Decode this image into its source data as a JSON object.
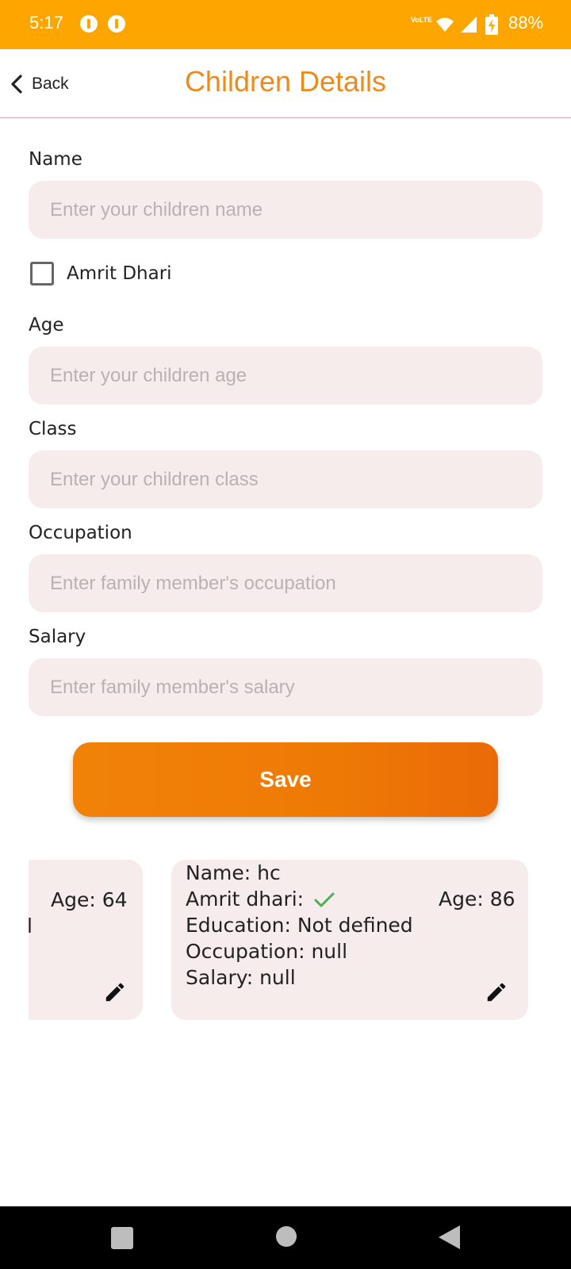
{
  "status_bar": {
    "time": "5:17",
    "network_label": "VoLTE",
    "battery": "88%"
  },
  "header": {
    "back_label": "Back",
    "title": "Children Details"
  },
  "form": {
    "name": {
      "label": "Name",
      "placeholder": "Enter your children name"
    },
    "amrit_dhari": {
      "label": "Amrit Dhari",
      "checked": false
    },
    "age": {
      "label": "Age",
      "placeholder": "Enter your children age"
    },
    "class": {
      "label": "Class",
      "placeholder": "Enter your children class"
    },
    "occupation": {
      "label": "Occupation",
      "placeholder": "Enter family member's occupation"
    },
    "salary": {
      "label": "Salary",
      "placeholder": "Enter family member's salary"
    },
    "save_label": "Save"
  },
  "cards": [
    {
      "age": "Age: 64",
      "cut_text": "l"
    },
    {
      "name": "Name: hc",
      "amrit_dhari": "Amrit dhari:",
      "age": "Age: 86",
      "education": "Education: Not defined",
      "occupation": "Occupation: null",
      "salary": "Salary: null"
    }
  ],
  "colors": {
    "status_bar": "#FFA500",
    "title": "#EE8A1C",
    "input_bg": "#F7ECEC",
    "save_button": "#EE7A05",
    "check": "#4CAF50"
  }
}
